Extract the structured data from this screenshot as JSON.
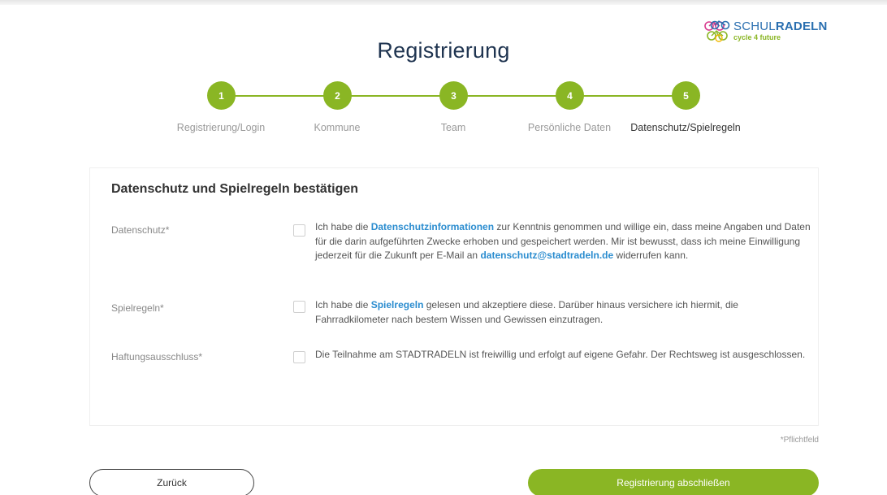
{
  "logo": {
    "brand_light": "SCHUL",
    "brand_bold": "RADELN",
    "tagline": "cycle 4 future"
  },
  "page": {
    "title": "Registrierung"
  },
  "stepper": {
    "steps": [
      {
        "number": "1",
        "label": "Registrierung/Login"
      },
      {
        "number": "2",
        "label": "Kommune"
      },
      {
        "number": "3",
        "label": "Team"
      },
      {
        "number": "4",
        "label": "Persönliche Daten"
      },
      {
        "number": "5",
        "label": "Datenschutz/Spielregeln",
        "active": true
      }
    ]
  },
  "form": {
    "heading": "Datenschutz und Spielregeln bestätigen",
    "rows": [
      {
        "label": "Datenschutz*",
        "checked": false,
        "text_1": "Ich habe die ",
        "link_1": "Datenschutzinformationen",
        "text_2": " zur Kenntnis genommen und willige ein, dass meine Angaben und Daten für die darin aufgeführten Zwecke erhoben und gespeichert werden. Mir ist bewusst, dass ich meine Einwilligung jederzeit für die Zukunft per E-Mail an ",
        "link_2": "datenschutz@stadtradeln.de",
        "text_3": " widerrufen kann."
      },
      {
        "label": "Spielregeln*",
        "checked": false,
        "text_1": "Ich habe die ",
        "link_1": "Spielregeln",
        "text_2": " gelesen und akzeptiere diese. Darüber hinaus versichere ich hiermit, die Fahrradkilometer nach bestem Wissen und Gewissen einzutragen."
      },
      {
        "label": "Haftungsausschluss*",
        "checked": false,
        "text_1": "Die Teilnahme am STADTRADELN ist freiwillig und erfolgt auf eigene Gefahr. Der Rechtsweg ist ausgeschlossen."
      }
    ],
    "required_note": "*Pflichtfeld"
  },
  "actions": {
    "back_label": "Zurück",
    "finish_label": "Registrierung abschließen"
  },
  "colors": {
    "accent": "#8ab624",
    "link": "#2a8ccf",
    "title": "#1f3450",
    "brand_blue": "#2a6fb0"
  }
}
